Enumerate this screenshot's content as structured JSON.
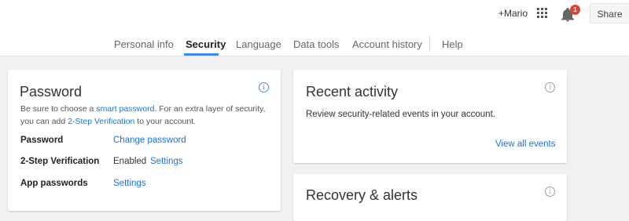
{
  "header": {
    "user_name": "+Mario",
    "notification_count": "1",
    "share_label": "Share"
  },
  "nav": {
    "tabs": [
      {
        "label": "Personal info"
      },
      {
        "label": "Security"
      },
      {
        "label": "Language"
      },
      {
        "label": "Data tools"
      },
      {
        "label": "Account history"
      },
      {
        "label": "Help"
      }
    ],
    "active_tab": "Security"
  },
  "password_card": {
    "title": "Password",
    "desc_part1": "Be sure to choose a ",
    "desc_link1": "smart password",
    "desc_part2": ". For an extra layer of security,",
    "desc_part3": "you can add ",
    "desc_link2": "2-Step Verification",
    "desc_part4": " to your account.",
    "rows": [
      {
        "label": "Password",
        "value": "",
        "link": "Change password"
      },
      {
        "label": "2-Step Verification",
        "value": "Enabled",
        "link": "Settings"
      },
      {
        "label": "App passwords",
        "value": "",
        "link": "Settings"
      }
    ]
  },
  "activity_card": {
    "title": "Recent activity",
    "description": "Review security-related events in your account.",
    "link": "View all events"
  },
  "recovery_card": {
    "title": "Recovery & alerts"
  },
  "colors": {
    "accent": "#4285f4",
    "link": "#1a73e8",
    "badge": "#db4437",
    "background": "#f1f1f1"
  },
  "icons": {
    "apps": "grid-apps-icon",
    "notifications": "bell-icon",
    "info": "info-icon"
  }
}
